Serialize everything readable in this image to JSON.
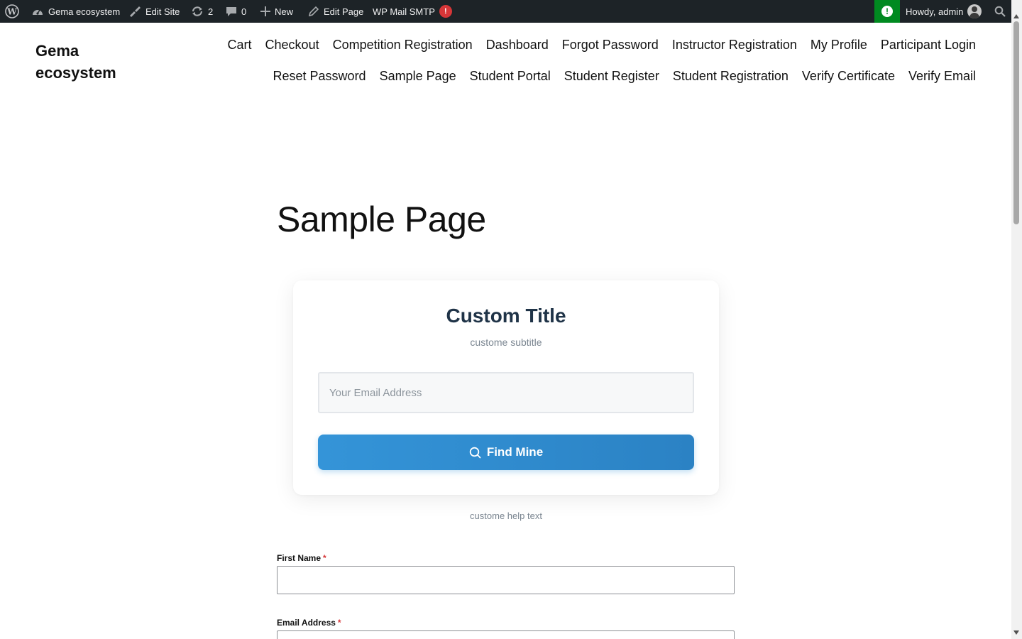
{
  "admin_bar": {
    "site_name": "Gema ecosystem",
    "edit_site": "Edit Site",
    "updates_count": "2",
    "comments_count": "0",
    "new_label": "New",
    "edit_page": "Edit Page",
    "smtp_label": "WP Mail SMTP",
    "smtp_alert": "!",
    "health_alert": "!",
    "howdy": "Howdy, admin"
  },
  "header": {
    "site_title": "Gema ecosystem",
    "nav_row1": [
      "Cart",
      "Checkout",
      "Competition Registration",
      "Dashboard",
      "Forgot Password",
      "Instructor Registration",
      "My Profile",
      "Participant Login"
    ],
    "nav_row2": [
      "Reset Password",
      "Sample Page",
      "Student Portal",
      "Student Register",
      "Student Registration",
      "Verify Certificate",
      "Verify Email"
    ]
  },
  "page": {
    "title": "Sample Page"
  },
  "lookup_card": {
    "title": "Custom Title",
    "subtitle": "custome subtitle",
    "email_placeholder": "Your Email Address",
    "email_value": "",
    "button_label": "Find Mine",
    "help_text": "custome help text"
  },
  "form": {
    "first_name_label": "First Name",
    "email_label": "Email Address",
    "required_mark": "*"
  },
  "colors": {
    "admin_bar_bg": "#1d2327",
    "button_accent": "#3494d8",
    "card_title": "#1f3347",
    "required": "#d63638",
    "health_green": "#008a20"
  }
}
